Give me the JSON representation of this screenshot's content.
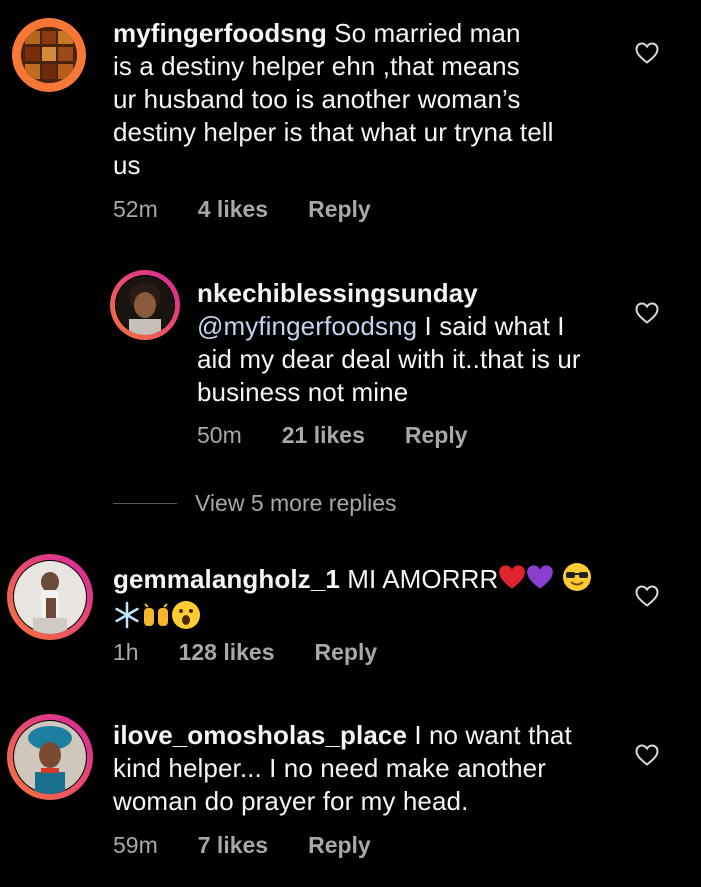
{
  "comments": [
    {
      "username": "myfingerfoodsng",
      "text_lines": [
        "So married man",
        "is a destiny helper ehn ,that means",
        "ur husband too is another woman’s",
        "destiny helper is that what ur tryna tell",
        "us"
      ],
      "time": "52m",
      "likes": "4 likes",
      "reply": "Reply",
      "avatar_icon": "food-collage-avatar"
    },
    {
      "username": "nkechiblessingsunday",
      "mention": "@myfingerfoodsng",
      "text_lines": [
        "I said what I",
        "aid my dear deal with it..that is ur",
        "business not mine"
      ],
      "time": "50m",
      "likes": "21 likes",
      "reply": "Reply",
      "avatar_icon": "woman-portrait-avatar"
    },
    {
      "username": "gemmalangholz_1",
      "text_lines": [
        "MI AMORRR"
      ],
      "time": "1h",
      "likes": "128 likes",
      "reply": "Reply",
      "avatar_icon": "woman-white-outfit-avatar",
      "emojis": [
        "red-heart",
        "purple-heart",
        "sunglasses-face",
        "snowflake",
        "raised-hands",
        "surprised-face"
      ]
    },
    {
      "username": "ilove_omosholas_place",
      "text_lines": [
        "I no want that",
        "kind helper... I no need make another",
        "woman do prayer for my head."
      ],
      "time": "59m",
      "likes": "7 likes",
      "reply": "Reply",
      "avatar_icon": "woman-blue-gele-avatar"
    }
  ],
  "view_more": "View 5 more replies",
  "colors": {
    "background": "#000000",
    "text": "#f5f5f5",
    "secondary": "#a8a8a8",
    "mention": "#c3d3f0",
    "story_ring_orange": "#f77737",
    "story_ring_pink": "#d6249f"
  }
}
